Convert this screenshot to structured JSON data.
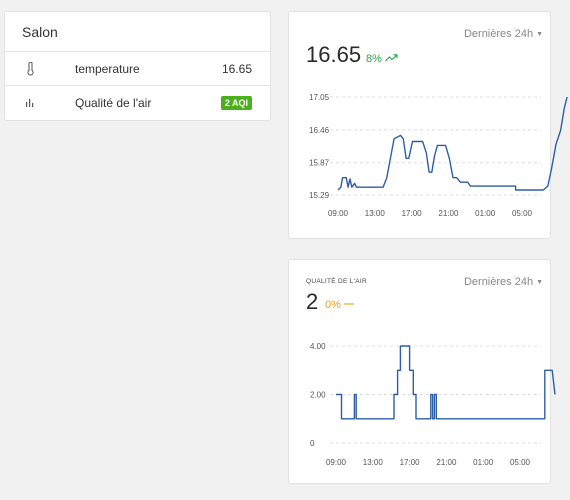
{
  "room": {
    "title": "Salon",
    "rows": [
      {
        "icon": "thermometer-icon",
        "label": "temperature",
        "value": "16.65"
      },
      {
        "icon": "bar-chart-icon",
        "label": "Qualité de l'air",
        "badge": "2 AQI"
      }
    ]
  },
  "temp_card": {
    "period": "Dernières 24h",
    "value": "16.65",
    "trend": "8%",
    "trend_icon": "trend-up-icon"
  },
  "air_card": {
    "subtitle": "QUALITÉ DE L'AIR",
    "period": "Dernières 24h",
    "value": "2",
    "trend": "0%",
    "trend_icon": "trend-flat-icon"
  },
  "colors": {
    "line": "#2d5ea6",
    "grid": "#dddddd",
    "up": "#27a745",
    "flat": "#e8a116",
    "badge": "#4caf1e"
  },
  "chart_data": [
    {
      "type": "line",
      "x": [
        "09:00",
        "13:00",
        "17:00",
        "21:00",
        "01:00",
        "05:00"
      ],
      "ylim": [
        15.29,
        17.05
      ],
      "yticks": [
        "17.05",
        "16.46",
        "15.87",
        "15.29"
      ],
      "series": [
        {
          "values": [
            [
              0,
              15.38
            ],
            [
              0.6,
              15.43
            ],
            [
              1.0,
              15.6
            ],
            [
              1.8,
              15.6
            ],
            [
              2.2,
              15.43
            ],
            [
              2.6,
              15.58
            ],
            [
              3.0,
              15.43
            ],
            [
              3.6,
              15.5
            ],
            [
              4.0,
              15.43
            ],
            [
              9.8,
              15.43
            ],
            [
              10.6,
              15.6
            ],
            [
              11.4,
              15.95
            ],
            [
              12.2,
              16.3
            ],
            [
              13.6,
              16.36
            ],
            [
              14.2,
              16.3
            ],
            [
              14.8,
              15.95
            ],
            [
              15.4,
              15.95
            ],
            [
              16.2,
              16.25
            ],
            [
              18.4,
              16.25
            ],
            [
              19.2,
              16.05
            ],
            [
              19.8,
              15.7
            ],
            [
              20.4,
              15.7
            ],
            [
              21.0,
              16.0
            ],
            [
              21.6,
              16.18
            ],
            [
              23.4,
              16.18
            ],
            [
              24.2,
              15.95
            ],
            [
              25.0,
              15.6
            ],
            [
              25.8,
              15.6
            ],
            [
              26.6,
              15.52
            ],
            [
              28.2,
              15.52
            ],
            [
              28.8,
              15.45
            ],
            [
              38.6,
              15.45
            ],
            [
              38.6,
              15.38
            ],
            [
              44.6,
              15.38
            ],
            [
              45.6,
              15.45
            ],
            [
              46.4,
              15.75
            ],
            [
              47.4,
              16.2
            ],
            [
              48.4,
              16.45
            ],
            [
              49.2,
              16.85
            ],
            [
              49.8,
              17.05
            ]
          ]
        }
      ]
    },
    {
      "type": "line",
      "x": [
        "09:00",
        "13:00",
        "17:00",
        "21:00",
        "01:00",
        "05:00"
      ],
      "ylim": [
        0,
        4.0
      ],
      "yticks": [
        "4.00",
        "2.00",
        "0"
      ],
      "series": [
        {
          "values": [
            [
              0,
              2.0
            ],
            [
              1.2,
              2.0
            ],
            [
              1.2,
              1.0
            ],
            [
              4.0,
              1.0
            ],
            [
              4.0,
              2.0
            ],
            [
              4.4,
              2.0
            ],
            [
              4.4,
              1.0
            ],
            [
              12.6,
              1.0
            ],
            [
              12.6,
              2.0
            ],
            [
              13.4,
              2.0
            ],
            [
              13.4,
              3.0
            ],
            [
              14.0,
              3.0
            ],
            [
              14.0,
              4.0
            ],
            [
              16.0,
              4.0
            ],
            [
              16.0,
              3.0
            ],
            [
              16.8,
              3.0
            ],
            [
              16.8,
              2.0
            ],
            [
              17.4,
              2.0
            ],
            [
              17.4,
              1.0
            ],
            [
              20.6,
              1.0
            ],
            [
              20.6,
              2.0
            ],
            [
              21.0,
              2.0
            ],
            [
              21.0,
              1.0
            ],
            [
              21.4,
              1.0
            ],
            [
              21.4,
              2.0
            ],
            [
              21.8,
              2.0
            ],
            [
              21.8,
              1.0
            ],
            [
              45.4,
              1.0
            ],
            [
              45.4,
              3.0
            ],
            [
              46.4,
              3.0
            ],
            [
              47.0,
              3.0
            ],
            [
              47.6,
              2.0
            ]
          ]
        }
      ]
    }
  ]
}
